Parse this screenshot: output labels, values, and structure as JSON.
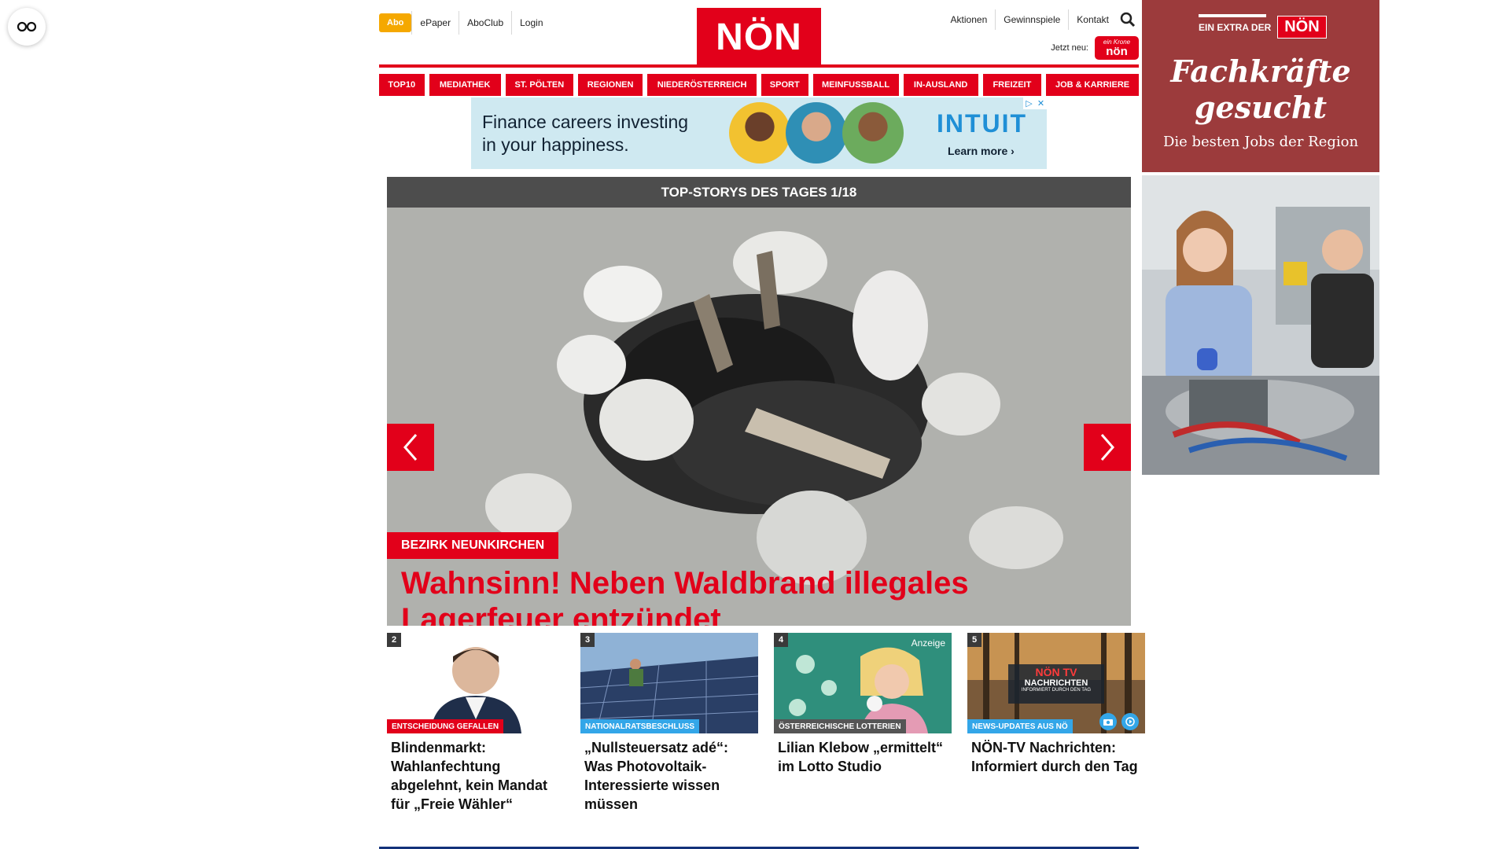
{
  "accessibility": {
    "icon": "accessibility-glasses-icon"
  },
  "header": {
    "abo_label": "Abo",
    "top_links": [
      "ePaper",
      "AboClub",
      "Login"
    ],
    "logo_text": "NÖN",
    "right_links": [
      "Aktionen",
      "Gewinnspiele",
      "Kontakt"
    ],
    "search_icon": "search-icon",
    "jetzt_label": "Jetzt neu:",
    "jetzt_logo_small": "ein Krone",
    "jetzt_logo_text": "nön"
  },
  "nav": {
    "items": [
      "TOP10",
      "MEDIATHEK",
      "ST. PÖLTEN",
      "REGIONEN",
      "NIEDERÖSTERREICH",
      "SPORT",
      "MEINFUSSBALL",
      "IN-AUSLAND",
      "FREIZEIT",
      "JOB & KARRIERE"
    ],
    "color": "#e2001a"
  },
  "top_ad": {
    "line1": "Finance careers investing",
    "line2": "in your happiness.",
    "brand": "INTUIT",
    "cta": "Learn more ›",
    "controls": [
      "▷",
      "✕"
    ]
  },
  "side_ad": {
    "extra_label": "EIN EXTRA DER",
    "extra_logo": "NÖN",
    "title_line1": "Fachkräfte",
    "title_line2": "gesucht",
    "subtitle": "Die besten Jobs der Region"
  },
  "slider": {
    "header": "TOP-STORYS DES TAGES 1/18",
    "category": "BEZIRK NEUNKIRCHEN",
    "title": "Wahnsinn! Neben Waldbrand illegales Lagerfeuer entzündet",
    "prev_icon": "chevron-left-icon",
    "next_icon": "chevron-right-icon"
  },
  "cards": [
    {
      "num": "2",
      "tag": "ENTSCHEIDUNG GEFALLEN",
      "tag_color": "#e2001a",
      "title": "Blindenmarkt: Wahlanfechtung abgelehnt, kein Mandat für „Freie Wähler“"
    },
    {
      "num": "3",
      "tag": "NATIONALRATSBESCHLUSS",
      "tag_color": "#33a6e8",
      "title": "„Nullsteuersatz adé“: Was Photovoltaik-Interessierte wissen müssen"
    },
    {
      "num": "4",
      "tag": "ÖSTERREICHISCHE LOTTERIEN",
      "tag_color": "#555555",
      "title": "Lilian Klebow „ermittelt“ im Lotto Studio",
      "badge": "Anzeige"
    },
    {
      "num": "5",
      "tag": "NEWS-UPDATES AUS NÖ",
      "tag_color": "#33a6e8",
      "title": "NÖN-TV Nachrichten: Informiert durch den Tag",
      "thumb_logo": "NÖN TV",
      "thumb_text": "NACHRICHTEN",
      "thumb_sub": "INFORMIERT DURCH DEN TAG"
    }
  ]
}
